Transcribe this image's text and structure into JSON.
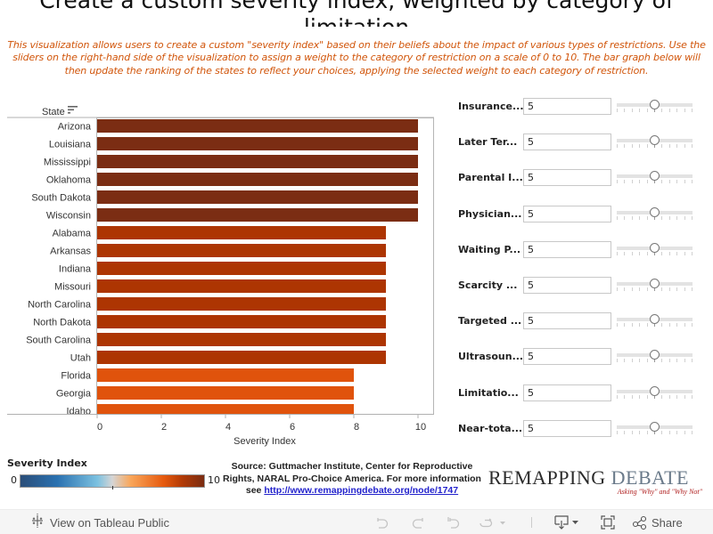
{
  "title": "Create a custom severity index, weighted by category of limitation",
  "description": "This visualization allows users to create a custom \"severity index\" based on their beliefs about the impact of various types of restrictions. Use the sliders on the right-hand side of the visualization to assign a weight to the category of restriction on a scale of 0 to 10. The bar graph below will then update the ranking of the states to reflect your choices, applying the selected weight to each category of restriction.",
  "chart_data": {
    "type": "bar",
    "orientation": "horizontal",
    "row_header": "State",
    "xlabel": "Severity Index",
    "xlim": [
      0,
      10
    ],
    "xticks": [
      0,
      2,
      4,
      6,
      8,
      10
    ],
    "grid": false,
    "categories": [
      "Arizona",
      "Louisiana",
      "Mississippi",
      "Oklahoma",
      "South Dakota",
      "Wisconsin",
      "Alabama",
      "Arkansas",
      "Indiana",
      "Missouri",
      "North Carolina",
      "North Dakota",
      "South Carolina",
      "Utah",
      "Florida",
      "Georgia",
      "Idaho"
    ],
    "values": [
      10,
      10,
      10,
      10,
      10,
      10,
      9,
      9,
      9,
      9,
      9,
      9,
      9,
      9,
      8,
      8,
      8
    ],
    "color_scale": {
      "field": "Severity Index",
      "min": 0,
      "max": 10,
      "colors": {
        "10": "#7b2d13",
        "9": "#ad3502",
        "8": "#e0530c"
      }
    }
  },
  "legend": {
    "title": "Severity Index",
    "min_label": "0",
    "max_label": "10"
  },
  "parameters": [
    {
      "label": "Insurance...",
      "value": "5",
      "slider_fraction": 0.5
    },
    {
      "label": "Later Ter...",
      "value": "5",
      "slider_fraction": 0.5
    },
    {
      "label": "Parental I...",
      "value": "5",
      "slider_fraction": 0.5
    },
    {
      "label": "Physician...",
      "value": "5",
      "slider_fraction": 0.5
    },
    {
      "label": "Waiting P...",
      "value": "5",
      "slider_fraction": 0.5
    },
    {
      "label": "Scarcity ...",
      "value": "5",
      "slider_fraction": 0.5
    },
    {
      "label": "Targeted ...",
      "value": "5",
      "slider_fraction": 0.5
    },
    {
      "label": "Ultrasoun...",
      "value": "5",
      "slider_fraction": 0.5
    },
    {
      "label": "Limitatio...",
      "value": "5",
      "slider_fraction": 0.5
    },
    {
      "label": "Near-tota...",
      "value": "5",
      "slider_fraction": 0.5
    }
  ],
  "source": {
    "line1": "Source: Guttmacher Institute, Center for Reproductive",
    "line2": "Rights, NARAL Pro-Choice America. For more information",
    "line3_prefix": "see ",
    "link": "http://www.remappingdebate.org/node/1747"
  },
  "logo": {
    "word1": "REMAPPING",
    "word2": "DEBATE",
    "tagline": "Asking \"Why\" and \"Why Not\""
  },
  "toolbar": {
    "view_on_tableau": "View on Tableau Public",
    "share": "Share",
    "icons": [
      "undo-icon",
      "redo-icon",
      "revert-icon",
      "refresh-icon",
      "download-icon",
      "fullscreen-icon",
      "share-icon"
    ]
  }
}
